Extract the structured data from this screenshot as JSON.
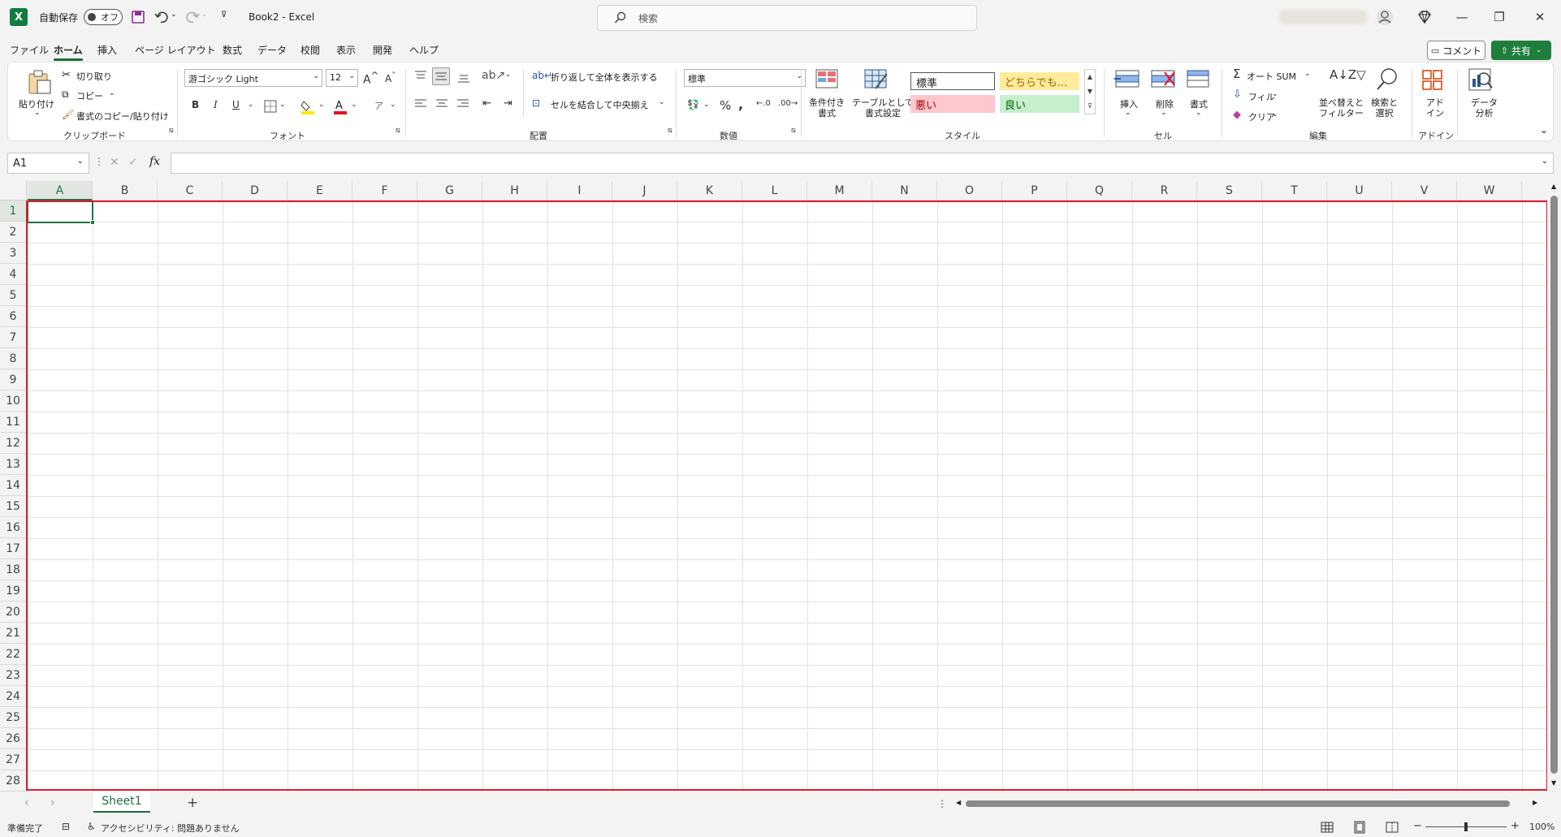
{
  "titlebar": {
    "autosave_label": "自動保存",
    "autosave_state": "オフ",
    "doc_title": "Book2  -  Excel",
    "search_placeholder": "検索"
  },
  "menu": {
    "items": [
      "ファイル",
      "ホーム",
      "挿入",
      "ページ レイアウト",
      "数式",
      "データ",
      "校閲",
      "表示",
      "開発",
      "ヘルプ"
    ],
    "active": "ホーム",
    "comment": "コメント",
    "share": "共有"
  },
  "ribbon": {
    "clipboard": {
      "paste": "貼り付け",
      "cut": "切り取り",
      "copy": "コピー",
      "format_painter": "書式のコピー/貼り付け",
      "group": "クリップボード"
    },
    "font": {
      "name": "游ゴシック Light",
      "size": "12",
      "bold": "B",
      "italic": "I",
      "underline": "U",
      "group": "フォント"
    },
    "alignment": {
      "wrap": "折り返して全体を表示する",
      "merge": "セルを結合して中央揃え",
      "group": "配置"
    },
    "number": {
      "format": "標準",
      "group": "数値"
    },
    "styles": {
      "conditional": "条件付き\n書式",
      "table": "テーブルとして\n書式設定",
      "normal": "標準",
      "neutral": "どちらでも...",
      "bad": "悪い",
      "good": "良い",
      "group": "スタイル"
    },
    "cells": {
      "insert": "挿入",
      "delete": "削除",
      "format": "書式",
      "group": "セル"
    },
    "editing": {
      "autosum": "オート SUM",
      "fill": "フィル",
      "clear": "クリア",
      "sort": "並べ替えと\nフィルター",
      "find": "検索と\n選択",
      "group": "編集"
    },
    "addins": {
      "addin": "アド\nイン",
      "group": "アドイン"
    },
    "analysis": {
      "data": "データ\n分析"
    }
  },
  "formula": {
    "namebox": "A1",
    "fx": "fx"
  },
  "grid": {
    "columns": [
      "A",
      "B",
      "C",
      "D",
      "E",
      "F",
      "G",
      "H",
      "I",
      "J",
      "K",
      "L",
      "M",
      "N",
      "O",
      "P",
      "Q",
      "R",
      "S",
      "T",
      "U",
      "V",
      "W"
    ],
    "rows": [
      "1",
      "2",
      "3",
      "4",
      "5",
      "6",
      "7",
      "8",
      "9",
      "10",
      "11",
      "12",
      "13",
      "14",
      "15",
      "16",
      "17",
      "18",
      "19",
      "20",
      "21",
      "22",
      "23",
      "24",
      "25",
      "26",
      "27",
      "28"
    ],
    "active_cell": "A1"
  },
  "tabs": {
    "sheet": "Sheet1",
    "add": "+"
  },
  "status": {
    "ready": "準備完了",
    "accessibility": "アクセシビリティ: 問題ありません",
    "zoom": "100%"
  },
  "colors": {
    "accent": "#217346",
    "highlight_frame": "#e01a2c",
    "share": "#1e7e3c"
  }
}
